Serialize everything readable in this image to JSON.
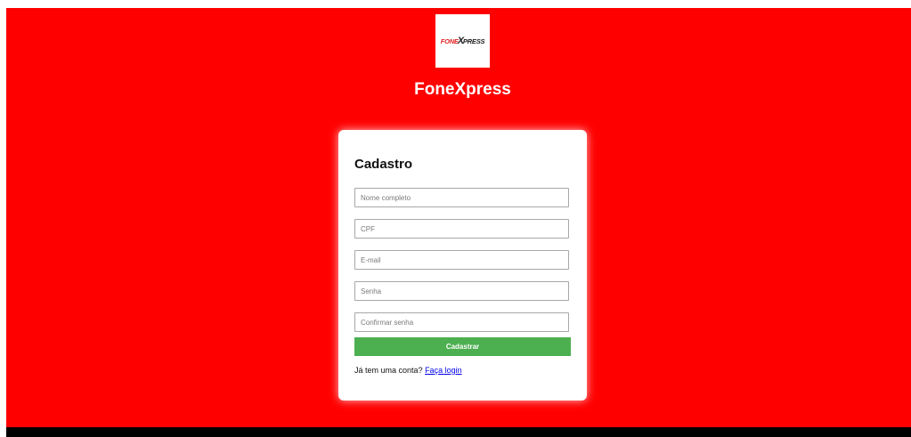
{
  "brand": {
    "logo_text_fone": "FONE",
    "logo_text_x": "X",
    "logo_text_press": "PRESS",
    "title": "FoneXpress"
  },
  "form": {
    "title": "Cadastro",
    "fields": [
      {
        "placeholder": "Nome completo",
        "value": ""
      },
      {
        "placeholder": "CPF",
        "value": ""
      },
      {
        "placeholder": "E-mail",
        "value": ""
      },
      {
        "placeholder": "Senha",
        "value": ""
      },
      {
        "placeholder": "Confirmar senha",
        "value": ""
      }
    ],
    "submit_label": "Cadastrar",
    "login_prompt": "Já tem uma conta?",
    "login_link": "Faça login"
  },
  "colors": {
    "background": "#ff0000",
    "card": "#ffffff",
    "button": "#4caf50",
    "link": "#0000ee",
    "footer_bar": "#000000"
  }
}
